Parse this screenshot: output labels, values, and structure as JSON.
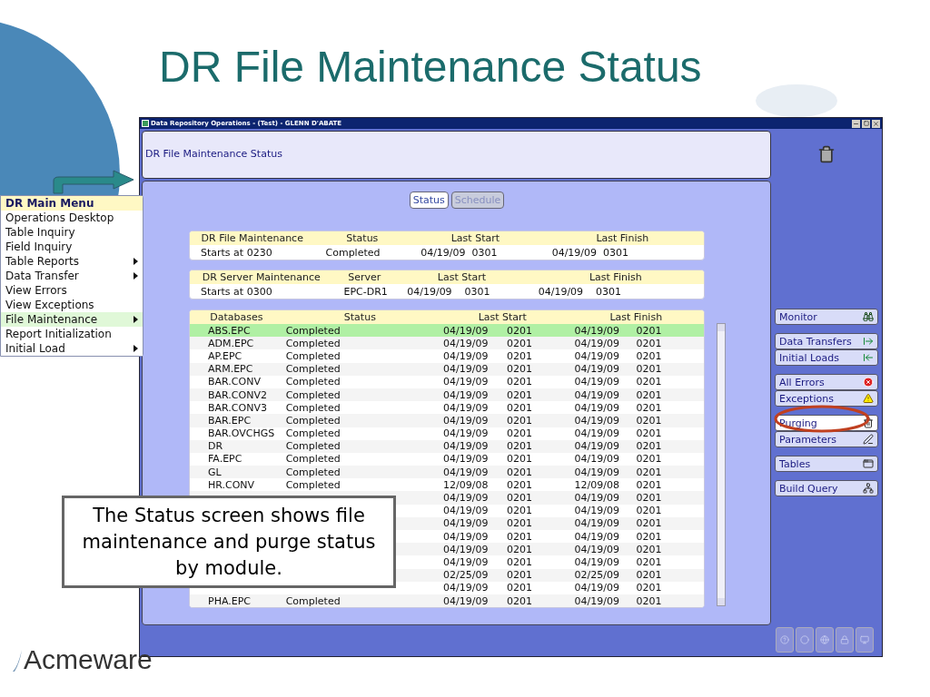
{
  "slide": {
    "title": "DR File Maintenance Status",
    "callout": "The Status screen shows file maintenance and purge status by module.",
    "logo": "Acmeware"
  },
  "window": {
    "title": "Data Repository Operations - (Test) - GLENN D'ABATE",
    "header": "DR File Maintenance Status"
  },
  "view_buttons": [
    {
      "label": "Status",
      "selected": true
    },
    {
      "label": "Schedule",
      "selected": false
    }
  ],
  "file_maintenance": {
    "columns": [
      "DR File Maintenance",
      "Status",
      "Last Start",
      "Last Finish"
    ],
    "row": {
      "schedule": "Starts at 0230",
      "status": "Completed",
      "last_start": "04/19/09  0301",
      "last_finish": "04/19/09  0301"
    }
  },
  "server_maintenance": {
    "columns": [
      "DR Server Maintenance",
      "Server",
      "Last Start",
      "Last Finish"
    ],
    "row": {
      "schedule": "Starts at 0300",
      "server": "EPC-DR1",
      "last_start": "04/19/09    0301",
      "last_finish": "04/19/09    0301"
    }
  },
  "databases": {
    "columns": [
      "Databases",
      "Status",
      "Last Start",
      "Last Finish"
    ],
    "rows": [
      {
        "name": "ABS.EPC",
        "status": "Completed",
        "start_date": "04/19/09",
        "start_time": "0201",
        "finish_date": "04/19/09",
        "finish_time": "0201",
        "selected": true
      },
      {
        "name": "ADM.EPC",
        "status": "Completed",
        "start_date": "04/19/09",
        "start_time": "0201",
        "finish_date": "04/19/09",
        "finish_time": "0201",
        "selected": false
      },
      {
        "name": "AP.EPC",
        "status": "Completed",
        "start_date": "04/19/09",
        "start_time": "0201",
        "finish_date": "04/19/09",
        "finish_time": "0201",
        "selected": false
      },
      {
        "name": "ARM.EPC",
        "status": "Completed",
        "start_date": "04/19/09",
        "start_time": "0201",
        "finish_date": "04/19/09",
        "finish_time": "0201",
        "selected": false
      },
      {
        "name": "BAR.CONV",
        "status": "Completed",
        "start_date": "04/19/09",
        "start_time": "0201",
        "finish_date": "04/19/09",
        "finish_time": "0201",
        "selected": false
      },
      {
        "name": "BAR.CONV2",
        "status": "Completed",
        "start_date": "04/19/09",
        "start_time": "0201",
        "finish_date": "04/19/09",
        "finish_time": "0201",
        "selected": false
      },
      {
        "name": "BAR.CONV3",
        "status": "Completed",
        "start_date": "04/19/09",
        "start_time": "0201",
        "finish_date": "04/19/09",
        "finish_time": "0201",
        "selected": false
      },
      {
        "name": "BAR.EPC",
        "status": "Completed",
        "start_date": "04/19/09",
        "start_time": "0201",
        "finish_date": "04/19/09",
        "finish_time": "0201",
        "selected": false
      },
      {
        "name": "BAR.OVCHGS",
        "status": "Completed",
        "start_date": "04/19/09",
        "start_time": "0201",
        "finish_date": "04/19/09",
        "finish_time": "0201",
        "selected": false
      },
      {
        "name": "DR",
        "status": "Completed",
        "start_date": "04/19/09",
        "start_time": "0201",
        "finish_date": "04/19/09",
        "finish_time": "0201",
        "selected": false
      },
      {
        "name": "FA.EPC",
        "status": "Completed",
        "start_date": "04/19/09",
        "start_time": "0201",
        "finish_date": "04/19/09",
        "finish_time": "0201",
        "selected": false
      },
      {
        "name": "GL",
        "status": "Completed",
        "start_date": "04/19/09",
        "start_time": "0201",
        "finish_date": "04/19/09",
        "finish_time": "0201",
        "selected": false
      },
      {
        "name": "HR.CONV",
        "status": "Completed",
        "start_date": "12/09/08",
        "start_time": "0201",
        "finish_date": "12/09/08",
        "finish_time": "0201",
        "selected": false
      },
      {
        "start_date": "04/19/09",
        "start_time": "0201",
        "finish_date": "04/19/09",
        "finish_time": "0201",
        "selected": false
      },
      {
        "start_date": "04/19/09",
        "start_time": "0201",
        "finish_date": "04/19/09",
        "finish_time": "0201",
        "selected": false
      },
      {
        "start_date": "04/19/09",
        "start_time": "0201",
        "finish_date": "04/19/09",
        "finish_time": "0201",
        "selected": false
      },
      {
        "start_date": "04/19/09",
        "start_time": "0201",
        "finish_date": "04/19/09",
        "finish_time": "0201",
        "selected": false
      },
      {
        "start_date": "04/19/09",
        "start_time": "0201",
        "finish_date": "04/19/09",
        "finish_time": "0201",
        "selected": false
      },
      {
        "start_date": "04/19/09",
        "start_time": "0201",
        "finish_date": "04/19/09",
        "finish_time": "0201",
        "selected": false
      },
      {
        "start_date": "02/25/09",
        "start_time": "0201",
        "finish_date": "02/25/09",
        "finish_time": "0201",
        "selected": false
      },
      {
        "start_date": "04/19/09",
        "start_time": "0201",
        "finish_date": "04/19/09",
        "finish_time": "0201",
        "selected": false
      },
      {
        "name": "PHA.EPC",
        "status": "Completed",
        "start_date": "04/19/09",
        "start_time": "0201",
        "finish_date": "04/19/09",
        "finish_time": "0201",
        "selected": false
      }
    ]
  },
  "side_buttons": [
    [
      {
        "label": "Monitor",
        "selected": false
      }
    ],
    [
      {
        "label": "Data Transfers",
        "selected": false
      },
      {
        "label": "Initial Loads",
        "selected": false
      }
    ],
    [
      {
        "label": "All Errors",
        "selected": false
      },
      {
        "label": "Exceptions",
        "selected": false
      }
    ],
    [
      {
        "label": "Purging",
        "selected": true
      },
      {
        "label": "Parameters",
        "selected": false
      }
    ],
    [
      {
        "label": "Tables",
        "selected": false
      }
    ],
    [
      {
        "label": "Build Query",
        "selected": false
      }
    ]
  ],
  "menu": {
    "title": "DR Main Menu",
    "items": [
      {
        "label": "Operations Desktop",
        "has_submenu": false,
        "selected": false
      },
      {
        "label": "Table Inquiry",
        "has_submenu": false,
        "selected": false
      },
      {
        "label": "Field Inquiry",
        "has_submenu": false,
        "selected": false
      },
      {
        "label": "Table Reports",
        "has_submenu": true,
        "selected": false
      },
      {
        "label": "Data Transfer",
        "has_submenu": true,
        "selected": false
      },
      {
        "label": "View Errors",
        "has_submenu": false,
        "selected": false
      },
      {
        "label": "View Exceptions",
        "has_submenu": false,
        "selected": false
      },
      {
        "label": "File Maintenance",
        "has_submenu": true,
        "selected": true
      },
      {
        "label": "Report Initialization",
        "has_submenu": false,
        "selected": false
      },
      {
        "label": "Initial Load",
        "has_submenu": true,
        "selected": false
      }
    ]
  }
}
